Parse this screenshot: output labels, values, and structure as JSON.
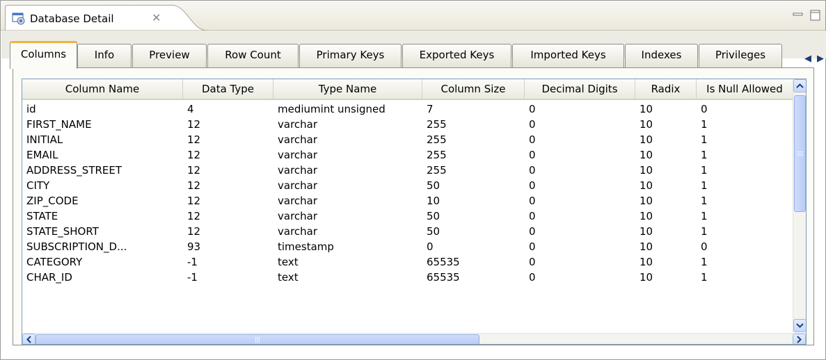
{
  "view": {
    "title": "Database Detail",
    "close_icon": "close-icon",
    "minimize_icon": "minimize-icon",
    "maximize_icon": "maximize-icon"
  },
  "tabs": [
    {
      "label": "Columns",
      "active": true
    },
    {
      "label": "Info",
      "active": false
    },
    {
      "label": "Preview",
      "active": false
    },
    {
      "label": "Row Count",
      "active": false
    },
    {
      "label": "Primary Keys",
      "active": false
    },
    {
      "label": "Exported Keys",
      "active": false
    },
    {
      "label": "Imported Keys",
      "active": false
    },
    {
      "label": "Indexes",
      "active": false
    },
    {
      "label": "Privileges",
      "active": false
    }
  ],
  "tab_scroll": {
    "left": "◀",
    "right": "▶"
  },
  "table": {
    "columns": [
      "Column Name",
      "Data Type",
      "Type Name",
      "Column Size",
      "Decimal Digits",
      "Radix",
      "Is Null Allowed"
    ],
    "rows": [
      [
        "id",
        "4",
        "mediumint unsigned",
        "7",
        "0",
        "10",
        "0"
      ],
      [
        "FIRST_NAME",
        "12",
        "varchar",
        "255",
        "0",
        "10",
        "1"
      ],
      [
        "INITIAL",
        "12",
        "varchar",
        "255",
        "0",
        "10",
        "1"
      ],
      [
        "EMAIL",
        "12",
        "varchar",
        "255",
        "0",
        "10",
        "1"
      ],
      [
        "ADDRESS_STREET",
        "12",
        "varchar",
        "255",
        "0",
        "10",
        "1"
      ],
      [
        "CITY",
        "12",
        "varchar",
        "50",
        "0",
        "10",
        "1"
      ],
      [
        "ZIP_CODE",
        "12",
        "varchar",
        "10",
        "0",
        "10",
        "1"
      ],
      [
        "STATE",
        "12",
        "varchar",
        "50",
        "0",
        "10",
        "1"
      ],
      [
        "STATE_SHORT",
        "12",
        "varchar",
        "50",
        "0",
        "10",
        "1"
      ],
      [
        "SUBSCRIPTION_D...",
        "93",
        "timestamp",
        "0",
        "0",
        "10",
        "0"
      ],
      [
        "CATEGORY",
        "-1",
        "text",
        "65535",
        "0",
        "10",
        "1"
      ],
      [
        "CHAR_ID",
        "-1",
        "text",
        "65535",
        "0",
        "10",
        "1"
      ]
    ]
  },
  "colors": {
    "active_tab_accent": "#f0b33b",
    "scrollbar_thumb": "#c5d7fa",
    "table_border": "#7f9db9"
  }
}
